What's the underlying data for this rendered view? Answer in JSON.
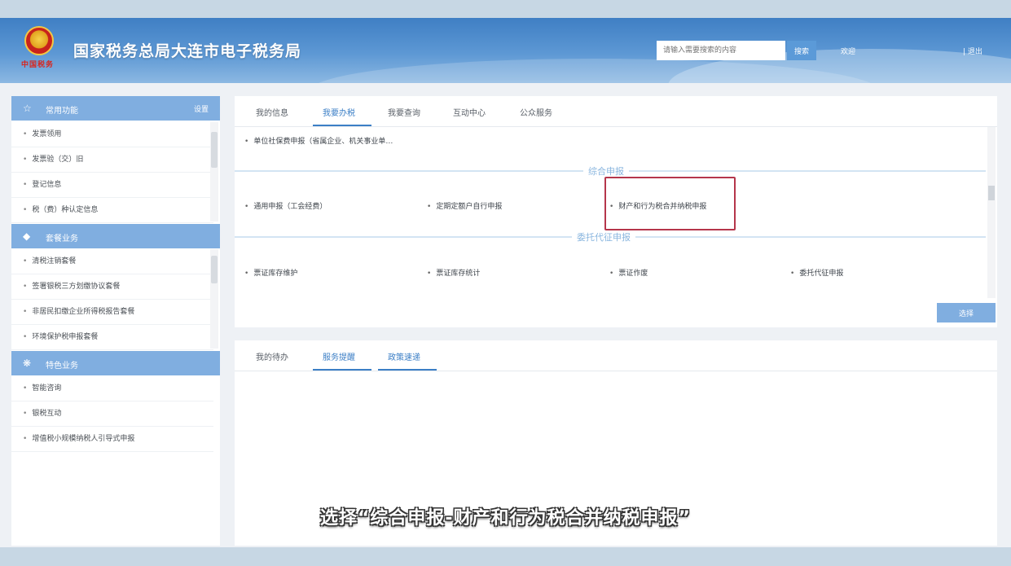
{
  "header": {
    "site_title": "国家税务总局大连市电子税务局",
    "seal_text": "中国税务",
    "search_placeholder": "请输入需要搜索的内容",
    "search_button": "搜索",
    "welcome": "欢迎",
    "logout": "| 退出"
  },
  "sidebar": {
    "sections": [
      {
        "title": "常用功能",
        "icon": "star-icon",
        "settings_label": "设置",
        "items": [
          "发票领用",
          "发票验（交）旧",
          "登记信息",
          "税（费）种认定信息"
        ]
      },
      {
        "title": "套餐业务",
        "icon": "package-icon",
        "items": [
          "清税注销套餐",
          "签署银税三方划缴协议套餐",
          "非居民扣缴企业所得税报告套餐",
          "环境保护税申报套餐"
        ]
      },
      {
        "title": "特色业务",
        "icon": "grid-icon",
        "items": [
          "智能咨询",
          "银税互动",
          "增值税小规模纳税人引导式申报"
        ]
      }
    ]
  },
  "main": {
    "tabs": [
      "我的信息",
      "我要办税",
      "我要查询",
      "互动中心",
      "公众服务"
    ],
    "active_tab": "我要办税",
    "top_item": "单位社保费申报（省属企业、机关事业单…",
    "group1": {
      "title": "综合申报",
      "items": [
        "通用申报（工会经费）",
        "定期定额户自行申报",
        "财产和行为税合并纳税申报"
      ]
    },
    "group2": {
      "title": "委托代征申报",
      "items": [
        "票证库存维护",
        "票证库存统计",
        "票证作废",
        "委托代征申报"
      ]
    },
    "confirm_button": "选择"
  },
  "lower": {
    "tabs": [
      "我的待办",
      "服务提醒",
      "政策速递"
    ]
  },
  "caption": "选择“综合申报-财产和行为税合并纳税申报”",
  "colors": {
    "accent": "#3c7fc6",
    "section_header": "#80aee0",
    "highlight": "#b5364b"
  }
}
